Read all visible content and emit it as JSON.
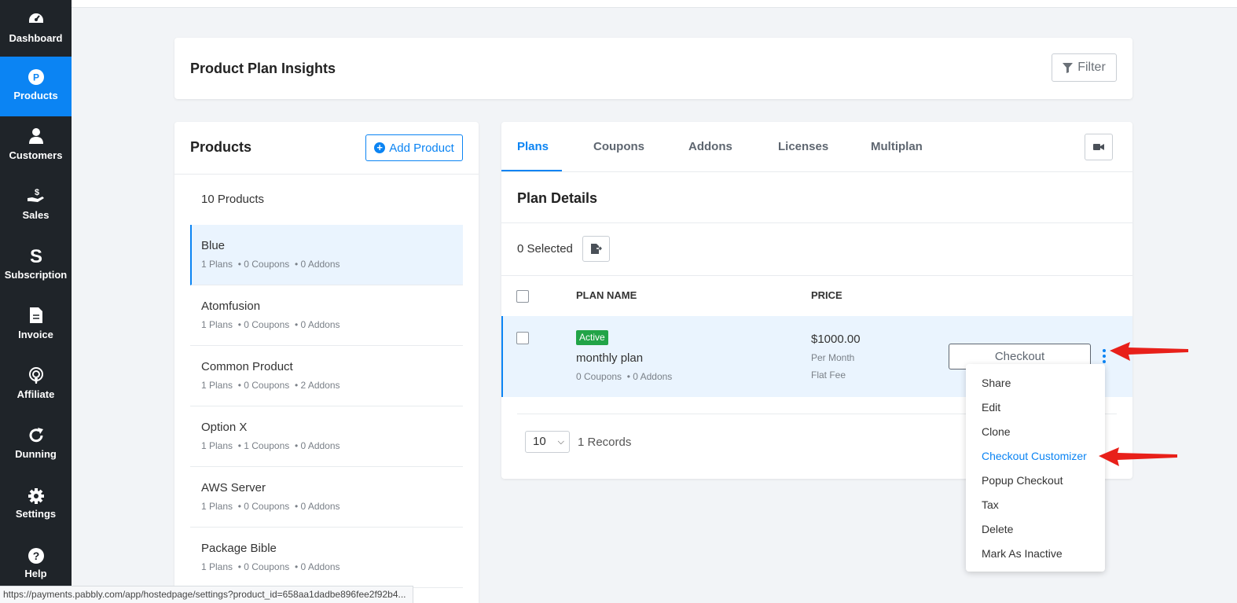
{
  "sidebar": {
    "items": [
      {
        "label": "Dashboard",
        "icon": "dashboard-icon",
        "active": false
      },
      {
        "label": "Products",
        "icon": "products-icon",
        "active": true
      },
      {
        "label": "Customers",
        "icon": "customers-icon",
        "active": false
      },
      {
        "label": "Sales",
        "icon": "sales-icon",
        "active": false
      },
      {
        "label": "Subscription",
        "icon": "subscription-icon",
        "active": false
      },
      {
        "label": "Invoice",
        "icon": "invoice-icon",
        "active": false
      },
      {
        "label": "Affiliate",
        "icon": "affiliate-icon",
        "active": false
      },
      {
        "label": "Dunning",
        "icon": "dunning-icon",
        "active": false
      },
      {
        "label": "Settings",
        "icon": "settings-icon",
        "active": false
      },
      {
        "label": "Help",
        "icon": "help-icon",
        "active": false
      }
    ]
  },
  "insights": {
    "title": "Product Plan Insights",
    "filter_label": "Filter"
  },
  "products": {
    "title": "Products",
    "add_label": "Add Product",
    "count_label": "10 Products",
    "items": [
      {
        "name": "Blue",
        "plans": "1 Plans",
        "coupons": "0 Coupons",
        "addons": "0 Addons"
      },
      {
        "name": "Atomfusion",
        "plans": "1 Plans",
        "coupons": "0 Coupons",
        "addons": "0 Addons"
      },
      {
        "name": "Common Product",
        "plans": "1 Plans",
        "coupons": "0 Coupons",
        "addons": "2 Addons"
      },
      {
        "name": "Option X",
        "plans": "1 Plans",
        "coupons": "1 Coupons",
        "addons": "0 Addons"
      },
      {
        "name": "AWS Server",
        "plans": "1 Plans",
        "coupons": "0 Coupons",
        "addons": "0 Addons"
      },
      {
        "name": "Package Bible",
        "plans": "1 Plans",
        "coupons": "0 Coupons",
        "addons": "0 Addons"
      }
    ]
  },
  "plans": {
    "tabs": [
      "Plans",
      "Coupons",
      "Addons",
      "Licenses",
      "Multiplan"
    ],
    "active_tab": "Plans",
    "details_title": "Plan Details",
    "selected_label": "0 Selected",
    "columns": {
      "plan_name": "PLAN NAME",
      "price": "PRICE"
    },
    "row": {
      "status": "Active",
      "name": "monthly plan",
      "coupons": "0 Coupons",
      "addons": "0 Addons",
      "price": "$1000.00",
      "period": "Per Month",
      "fee_type": "Flat Fee",
      "checkout_label": "Checkout"
    },
    "page_size": "10",
    "records_label": "1 Records"
  },
  "menu": {
    "items": [
      "Share",
      "Edit",
      "Clone",
      "Checkout Customizer",
      "Popup Checkout",
      "Tax",
      "Delete",
      "Mark As Inactive"
    ],
    "highlighted": "Checkout Customizer"
  },
  "statusbar": {
    "url": "https://payments.pabbly.com/app/hostedpage/settings?product_id=658aa1dadbe896fee2f92b4..."
  },
  "colors": {
    "accent": "#0b84f3",
    "sidebar_bg": "#1f2429",
    "active_badge": "#22a447",
    "annotation_arrow": "#e8201a"
  }
}
